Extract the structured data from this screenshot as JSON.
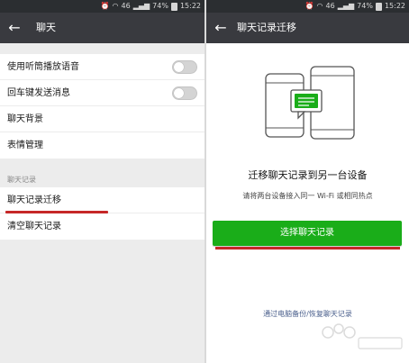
{
  "status_bar": {
    "signal": "46",
    "battery": "74%",
    "time": "15:22"
  },
  "left": {
    "title": "聊天",
    "rows": [
      {
        "label": "使用听筒播放语音",
        "toggle": "off"
      },
      {
        "label": "回车键发送消息",
        "toggle": "off"
      },
      {
        "label": "聊天背景"
      },
      {
        "label": "表情管理"
      }
    ],
    "section_label": "聊天记录",
    "history_rows": [
      {
        "label": "聊天记录迁移"
      },
      {
        "label": "清空聊天记录"
      }
    ]
  },
  "right": {
    "title": "聊天记录迁移",
    "heading": "迁移聊天记录到另一台设备",
    "subtitle": "请将两台设备接入同一 Wi-Fi 或相同热点",
    "button_label": "选择聊天记录",
    "backup_link": "通过电脑备份/恢复聊天记录"
  },
  "colors": {
    "status_bar": "#2b2e31",
    "app_bar": "#393a3f",
    "primary_button": "#1aad19",
    "annotation_red": "#c62828",
    "chat_bubble": "#1aad19"
  },
  "icons": {
    "back": "arrow-left-icon",
    "illustration": "phones-transfer-illustration"
  }
}
